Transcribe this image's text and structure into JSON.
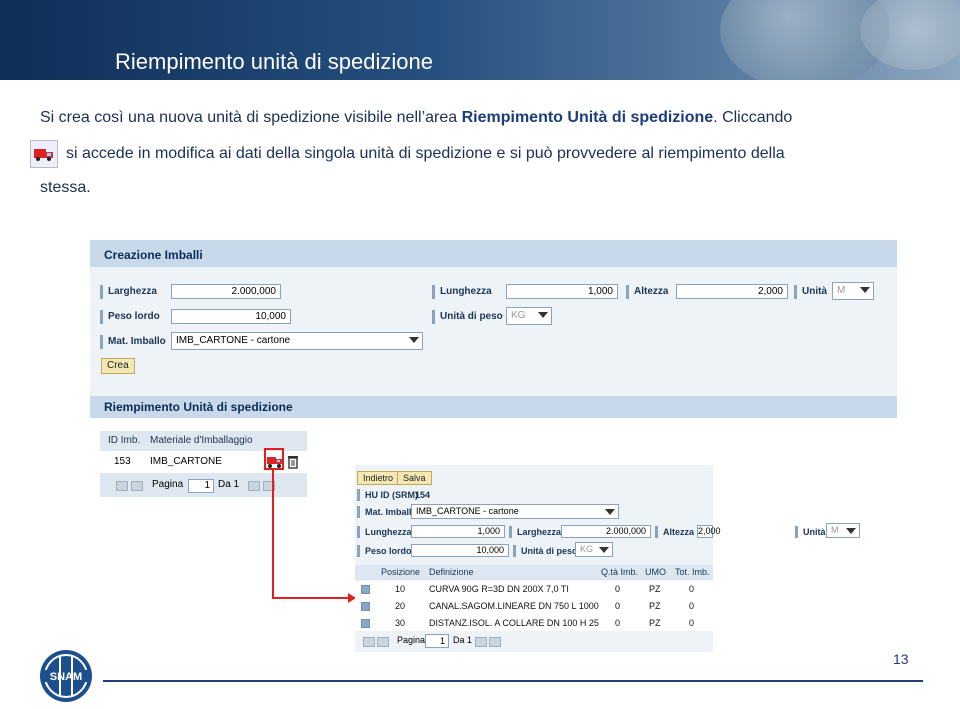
{
  "slide": {
    "title": "Riempimento unità di spedizione",
    "para_line1_a": "Si crea così una nuova unità di spedizione visibile nell’area ",
    "para_line1_b": "Riempimento Unità di spedizione",
    "para_line1_c": ". Cliccando",
    "para_line2": "si accede in modifica ai dati della singola unità di spedizione e si può provvedere al riempimento della",
    "para_line3": "stessa.",
    "page_number": "13",
    "logo_text": "SNAM"
  },
  "creazione": {
    "header": "Creazione Imballi",
    "larghezza_label": "Larghezza",
    "larghezza_value": "2.000,000",
    "lunghezza_label": "Lunghezza",
    "lunghezza_value": "1,000",
    "altezza_label": "Altezza",
    "altezza_value": "2,000",
    "unita_label": "Unità",
    "unita_value": "M",
    "peso_label": "Peso lordo",
    "peso_value": "10,000",
    "unita_peso_label": "Unità di peso",
    "unita_peso_value": "KG",
    "mat_label": "Mat. Imballo",
    "mat_value": "IMB_CARTONE - cartone",
    "crea_button": "Crea",
    "riempimento_header": "Riempimento Unità di spedizione"
  },
  "grid1": {
    "col1": "ID Imb.",
    "col2": "Materiale d'Imballaggio",
    "row_id": "153",
    "row_mat": "IMB_CARTONE",
    "pagina_label": "Pagina",
    "pagina_value": "1",
    "da_label": "Da 1"
  },
  "detail": {
    "indietro_button": "Indietro",
    "salva_button": "Salva",
    "hu_label": "HU ID (SRM)",
    "hu_value": "154",
    "mat_label": "Mat. Imballo",
    "mat_value": "IMB_CARTONE - cartone",
    "lunghezza_label": "Lunghezza",
    "lunghezza_value": "1,000",
    "larghezza_label": "Larghezza",
    "larghezza_value": "2.000,000",
    "altezza_label": "Altezza",
    "altezza_value": "2,000",
    "unita_label": "Unità",
    "unita_value": "M",
    "peso_label": "Peso lordo",
    "peso_value": "10,000",
    "unita_peso_label": "Unità di peso",
    "unita_peso_value": "KG",
    "columns": [
      "Posizione",
      "Definizione",
      "Q.tà Imb.",
      "UMO",
      "Tot. Imb."
    ],
    "rows": [
      {
        "pos": "10",
        "def": "CURVA 90G R=3D DN 200X 7,0 TI",
        "qta": "0",
        "umo": "PZ",
        "tot": "0"
      },
      {
        "pos": "20",
        "def": "CANAL.SAGOM.LINEARE DN 750 L 1000",
        "qta": "0",
        "umo": "PZ",
        "tot": "0"
      },
      {
        "pos": "30",
        "def": "DISTANZ.ISOL. A COLLARE DN 100 H 25",
        "qta": "0",
        "umo": "PZ",
        "tot": "0"
      }
    ],
    "pagina_label": "Pagina",
    "pagina_value": "1",
    "da_label": "Da 1"
  }
}
